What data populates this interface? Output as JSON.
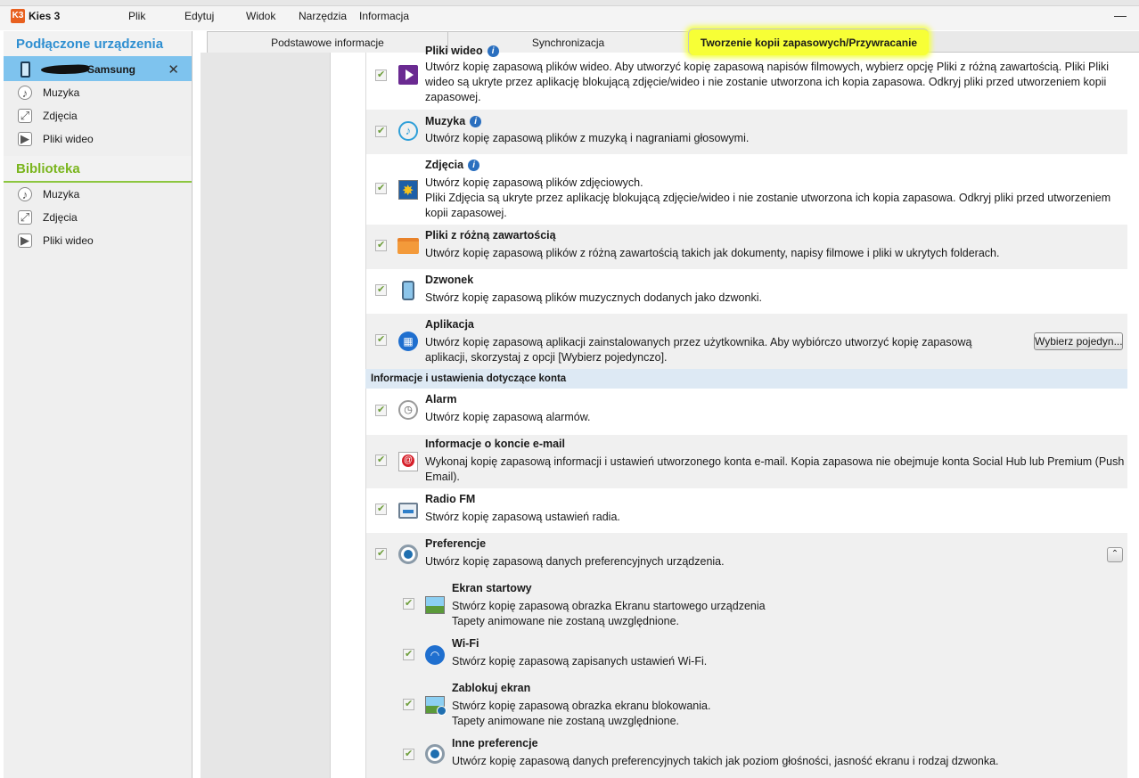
{
  "app": {
    "title": "Kies 3",
    "logo_text": "K3"
  },
  "menu": [
    "Plik",
    "Edytuj",
    "Widok",
    "Narzędzia",
    "Informacja"
  ],
  "sidebar": {
    "connected_header": "Podłączone urządzenia",
    "device_name": "Samsung",
    "device_items": [
      "Muzyka",
      "Zdjęcia",
      "Pliki wideo"
    ],
    "library_header": "Biblioteka",
    "library_items": [
      "Muzyka",
      "Zdjęcia",
      "Pliki wideo"
    ]
  },
  "tabs": [
    "Podstawowe informacje",
    "Synchronizacja",
    "Tworzenie kopii zapasowych/Przywracanie"
  ],
  "items": {
    "video": {
      "title": "Pliki wideo",
      "desc": "Utwórz kopię zapasową plików wideo. Aby utworzyć kopię zapasową napisów filmowych, wybierz opcję Pliki z różną zawartością. Pliki Pliki wideo są ukryte przez aplikację blokującą zdjęcie/wideo i nie zostanie utworzona ich kopia zapasowa. Odkryj pliki przed utworzeniem kopii zapasowej."
    },
    "music": {
      "title": "Muzyka",
      "desc": "Utwórz kopię zapasową plików z muzyką i nagraniami głosowymi."
    },
    "photos": {
      "title": "Zdjęcia",
      "desc1": "Utwórz kopię zapasową plików zdjęciowych.",
      "desc2": "Pliki Zdjęcia są ukryte przez aplikację blokującą zdjęcie/wideo i nie zostanie utworzona ich kopia zapasowa. Odkryj pliki przed utworzeniem kopii zapasowej."
    },
    "files": {
      "title": "Pliki z różną zawartością",
      "desc": "Utwórz kopię zapasową plików z różną zawartością takich jak dokumenty, napisy filmowe i pliki w ukrytych folderach."
    },
    "ringtone": {
      "title": "Dzwonek",
      "desc": "Stwórz kopię zapasową plików muzycznych dodanych jako dzwonki."
    },
    "apps": {
      "title": "Aplikacja",
      "desc": "Utwórz kopię zapasową aplikacji zainstalowanych przez użytkownika. Aby wybiórczo utworzyć kopię zapasową aplikacji, skorzystaj z opcji [Wybierz pojedynczo].",
      "button": "Wybierz pojedyn..."
    },
    "account_header": "Informacje i ustawienia dotyczące konta",
    "alarm": {
      "title": "Alarm",
      "desc": "Utwórz kopię zapasową alarmów."
    },
    "email": {
      "title": "Informacje o koncie e-mail",
      "desc": "Wykonaj kopię zapasową informacji i ustawień utworzonego konta e-mail. Kopia zapasowa nie obejmuje konta Social Hub lub Premium (Push Email)."
    },
    "radio": {
      "title": "Radio FM",
      "desc": "Stwórz kopię zapasową ustawień radia."
    },
    "prefs": {
      "title": "Preferencje",
      "desc": "Utwórz kopię zapasową danych preferencyjnych urządzenia.",
      "collapse_glyph": "⌃"
    },
    "home": {
      "title": "Ekran startowy",
      "desc1": "Stwórz kopię zapasową obrazka Ekranu startowego urządzenia",
      "desc2": "Tapety animowane nie zostaną uwzględnione."
    },
    "wifi": {
      "title": "Wi-Fi",
      "desc": "Stwórz kopię zapasową zapisanych ustawień Wi-Fi."
    },
    "lock": {
      "title": "Zablokuj ekran",
      "desc1": "Stwórz kopię zapasową obrazka ekranu blokowania.",
      "desc2": "Tapety animowane nie zostaną uwzględnione."
    },
    "other": {
      "title": "Inne preferencje",
      "desc": "Utwórz kopię zapasową danych preferencyjnych takich jak poziom głośności, jasność ekranu i rodzaj dzwonka."
    }
  },
  "colors": {
    "accent_green": "#8cc63f",
    "accent_blue": "#2f8fd1",
    "highlight": "#f7ff36"
  }
}
